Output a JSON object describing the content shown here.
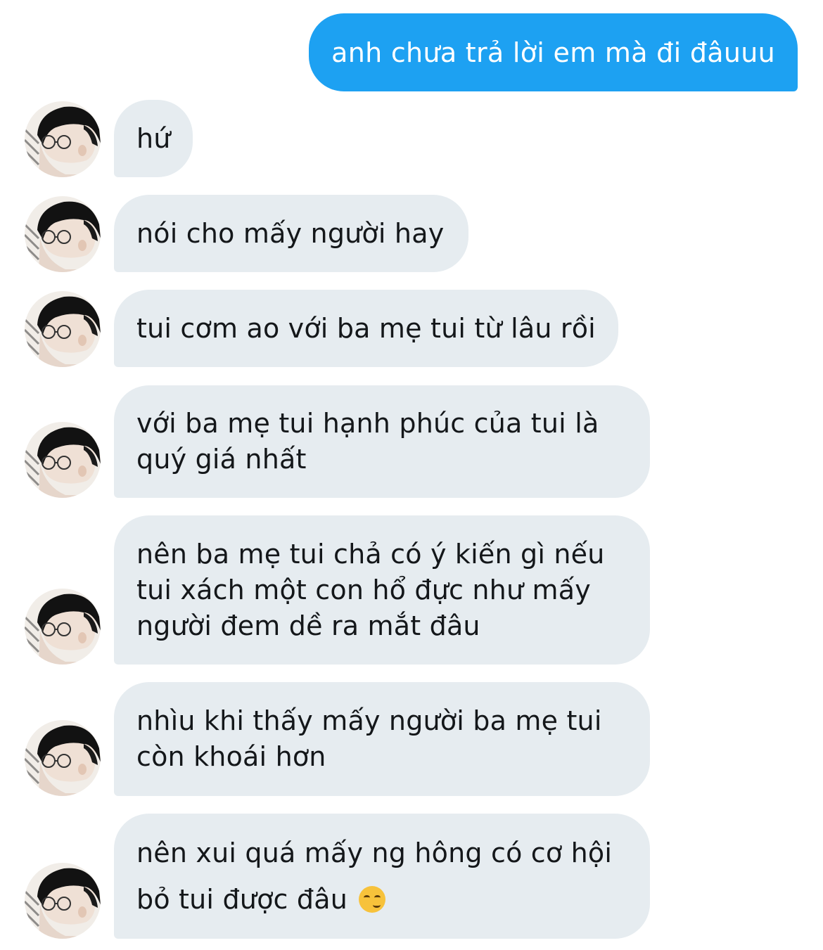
{
  "sent_message": {
    "text": "anh chưa trả lời em mà đi đâuuu",
    "color": "#1da1f2"
  },
  "received_messages": [
    {
      "text": "hứ"
    },
    {
      "text": "nói cho mấy người hay"
    },
    {
      "text": "tui cơm ao với ba mẹ tui từ lâu rồi"
    },
    {
      "text": "với ba mẹ tui hạnh phúc của tui là\nquý giá nhất"
    },
    {
      "text": "nên ba mẹ tui chả có ý kiến gì nếu\ntui xách một con hổ đực như mấy\nngười đem dề ra mắt đâu"
    },
    {
      "text": "nhìu khi thấy mấy người ba mẹ tui\ncòn khoái hơn"
    },
    {
      "text": "nên xui quá mấy ng hông có cơ hội\nbỏ tui được đâu",
      "emoji": "smirking-face-emoji"
    }
  ],
  "bubble_color": "#e6ecf0",
  "avatar_icon": "avatar"
}
